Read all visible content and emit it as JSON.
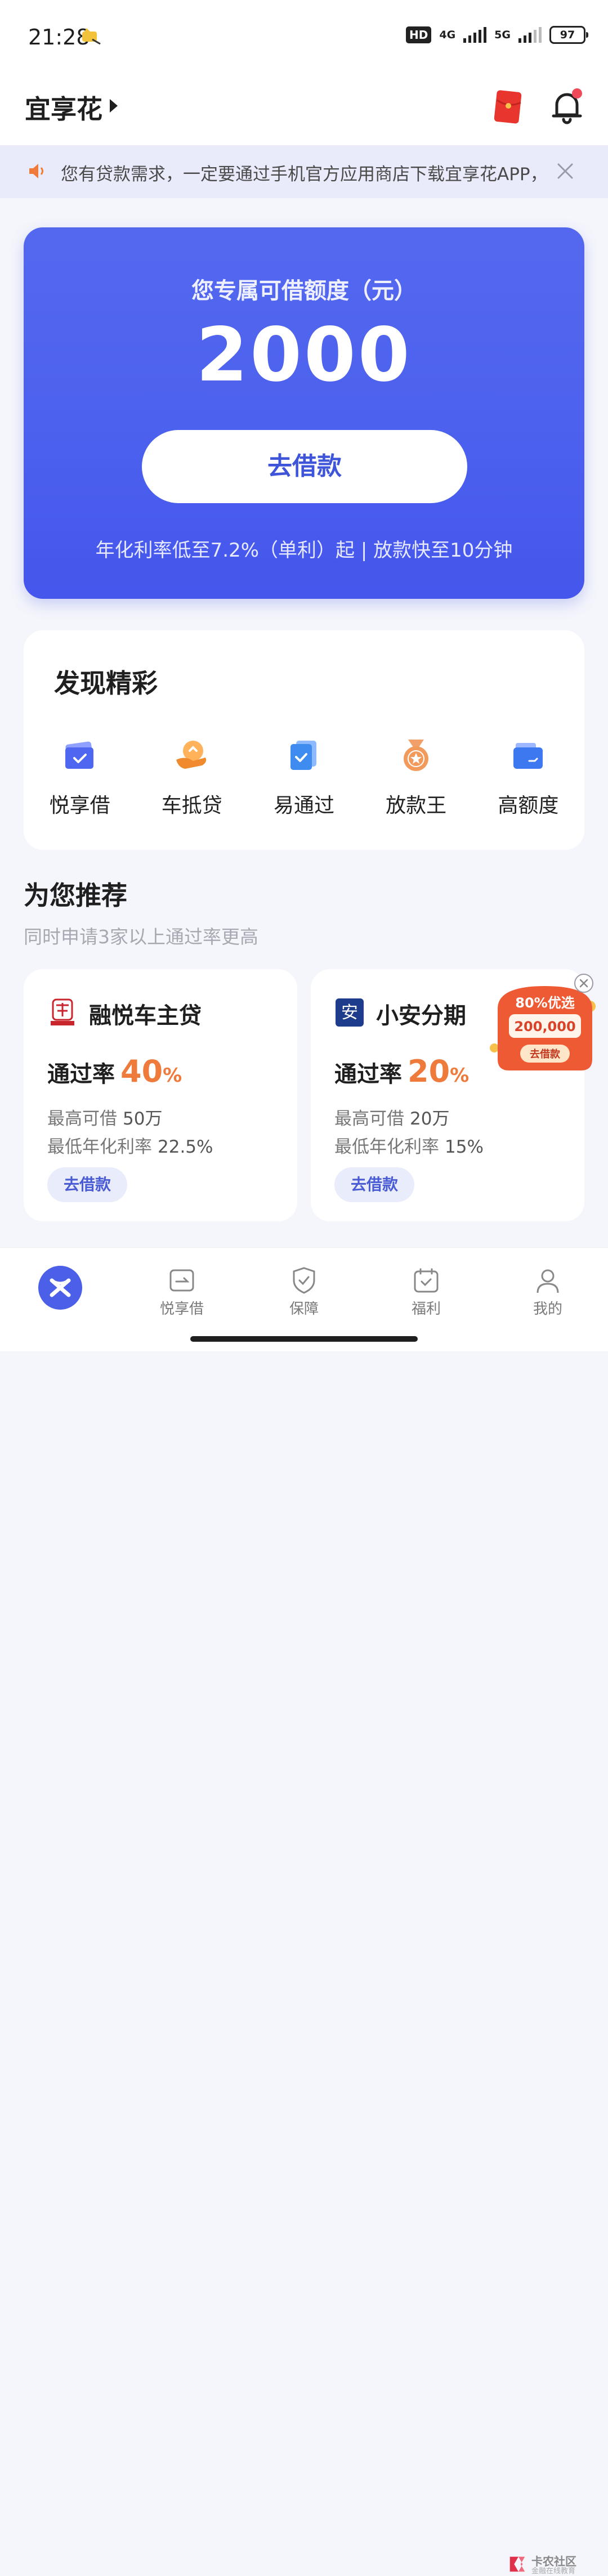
{
  "status_bar": {
    "time": "21:28",
    "hd_badge": "HD",
    "network_1": "4G",
    "network_2": "5G",
    "battery": "97"
  },
  "app_bar": {
    "title": "宜享花"
  },
  "notice": {
    "text": "您有贷款需求，一定要通过手机官方应用商店下载宜享花APP，"
  },
  "credit_card": {
    "label": "您专属可借额度（元）",
    "amount": "2000",
    "button_label": "去借款",
    "note": "年化利率低至7.2%（单利）起 | 放款快至10分钟"
  },
  "discover": {
    "title": "发现精彩",
    "items": [
      {
        "label": "悦享借",
        "icon": "card-check-icon"
      },
      {
        "label": "车抵贷",
        "icon": "car-loan-icon"
      },
      {
        "label": "易通过",
        "icon": "doc-check-icon"
      },
      {
        "label": "放款王",
        "icon": "medal-icon"
      },
      {
        "label": "高额度",
        "icon": "wallet-icon"
      }
    ]
  },
  "recommend": {
    "title": "为您推荐",
    "subtitle": "同时申请3家以上通过率更高",
    "cards": [
      {
        "name": "融悦车主贷",
        "rate_label": "通过率",
        "rate_value": "40",
        "rate_unit": "%",
        "max_label": "最高可借",
        "max_value": "50万",
        "min_rate_label": "最低年化利率",
        "min_rate_value": "22.5%",
        "button_label": "去借款"
      },
      {
        "name": "小安分期",
        "logo_char": "安",
        "rate_label": "通过率",
        "rate_value": "20",
        "rate_unit": "%",
        "max_label": "最高可借",
        "max_value": "20万",
        "min_rate_label": "最低年化利率",
        "min_rate_value": "15%",
        "button_label": "去借款"
      }
    ]
  },
  "promo": {
    "headline": "80%优选",
    "amount": "200,000",
    "button": "去借款"
  },
  "tab_bar": {
    "tabs": [
      {
        "label": "悦享借"
      },
      {
        "label": "保障"
      },
      {
        "label": "福利"
      },
      {
        "label": "我的"
      }
    ]
  },
  "watermark": {
    "text": "卡农社区",
    "sub": "金融在线教育"
  },
  "colors": {
    "primary": "#4b5fe8",
    "accent_orange": "#ee7a3c",
    "notice_bg": "#e9ebfb",
    "page_bg": "#f5f6fc"
  }
}
